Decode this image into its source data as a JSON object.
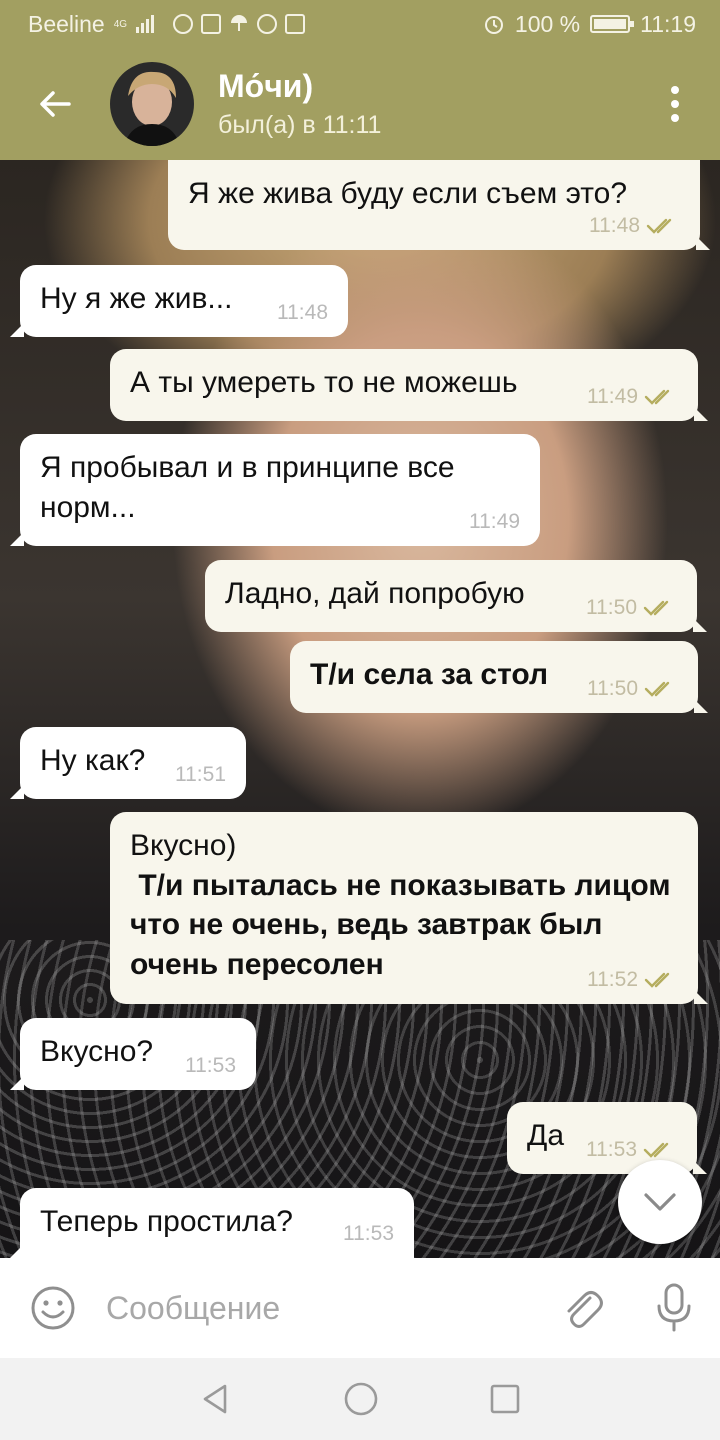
{
  "status_bar": {
    "carrier": "Beeline",
    "network": "4G",
    "battery": "100 %",
    "battery_level": 1.0,
    "time": "11:19"
  },
  "header": {
    "title": "Мо́чи)",
    "subtitle": "был(а) в 11:11",
    "back_icon": "arrow-left-icon",
    "menu_icon": "more-vertical-icon"
  },
  "messages": [
    {
      "dir": "out",
      "text": "Я же жива буду если съем это?",
      "time": "11:48",
      "read": true
    },
    {
      "dir": "in",
      "text": "Ну я же жив...",
      "time": "11:48"
    },
    {
      "dir": "out",
      "text": "А ты умереть то не можешь",
      "time": "11:49",
      "read": true
    },
    {
      "dir": "in",
      "text": "Я пробывал и в принципе все норм...",
      "time": "11:49"
    },
    {
      "dir": "out",
      "text": "Ладно, дай попробую",
      "time": "11:50",
      "read": true
    },
    {
      "dir": "out",
      "text": "Т/и села за стол",
      "time": "11:50",
      "read": true,
      "bold": true
    },
    {
      "dir": "in",
      "text": "Ну как?",
      "time": "11:51"
    },
    {
      "dir": "out",
      "text": "Вкусно)",
      "text_bold": " Т/и пыталась не показывать лицом что не очень, ведь завтрак был очень пересолен",
      "time": "11:52",
      "read": true
    },
    {
      "dir": "in",
      "text": "Вкусно?",
      "time": "11:53"
    },
    {
      "dir": "out",
      "text": "Да",
      "time": "11:53",
      "read": true
    },
    {
      "dir": "in",
      "text": "Теперь простила?",
      "time": "11:53"
    }
  ],
  "input": {
    "placeholder": "Сообщение"
  },
  "colors": {
    "header": "#a29f61",
    "outgoing_bubble": "#f8f6ec",
    "incoming_bubble": "#ffffff",
    "read_ticks": "#b5ad5f"
  }
}
